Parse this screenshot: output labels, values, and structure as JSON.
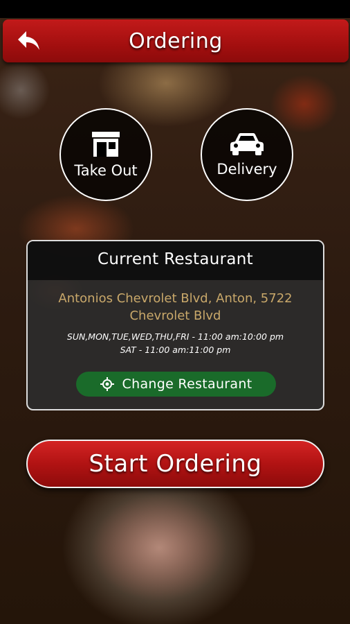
{
  "header": {
    "title": "Ordering",
    "back_icon": "back-arrow-icon"
  },
  "order_types": [
    {
      "label": "Take Out",
      "icon": "storefront-icon"
    },
    {
      "label": "Delivery",
      "icon": "car-icon"
    }
  ],
  "restaurant": {
    "heading": "Current Restaurant",
    "address": "Antonios Chevrolet Blvd, Anton, 5722 Chevrolet Blvd",
    "hours_line1": "SUN,MON,TUE,WED,THU,FRI - 11:00 am:10:00 pm",
    "hours_line2": "SAT - 11:00 am:11:00 pm",
    "change_label": "Change Restaurant",
    "change_icon": "location-target-icon"
  },
  "start_button": {
    "label": "Start Ordering"
  },
  "colors": {
    "primary_red": "#b11313",
    "change_green": "#1a6b2a",
    "address_gold": "#c9a86a"
  }
}
